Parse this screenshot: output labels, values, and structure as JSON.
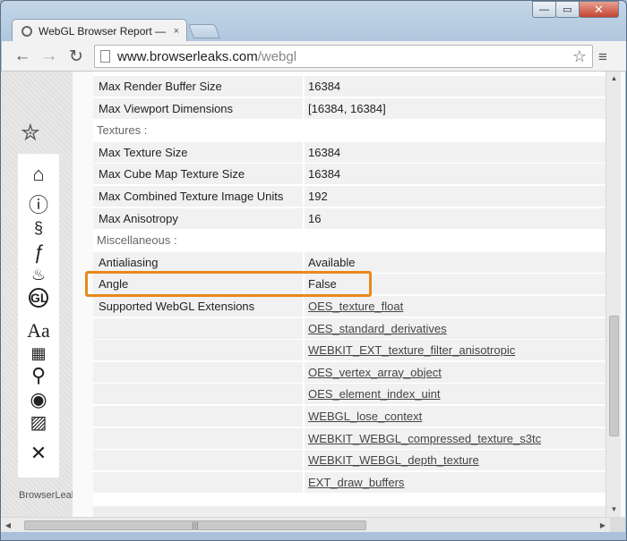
{
  "window": {
    "minimize_glyph": "—",
    "maximize_glyph": "▭",
    "close_glyph": "✕"
  },
  "tab": {
    "title": "WebGL Browser Report —",
    "close_glyph": "×"
  },
  "toolbar": {
    "back_glyph": "←",
    "forward_glyph": "→",
    "reload_glyph": "↻",
    "url_host": "www.browserleaks.com",
    "url_path": "/webgl",
    "star_glyph": "☆",
    "menu_glyph": "≡"
  },
  "sidebar": {
    "brand": "BrowserLeaks",
    "icons": [
      {
        "name": "pin-icon",
        "glyph": "📌"
      },
      {
        "name": "home-icon",
        "glyph": "⌂"
      },
      {
        "name": "info-icon",
        "glyph": "ⓘ"
      },
      {
        "name": "script-icon",
        "glyph": "📜"
      },
      {
        "name": "flash-icon",
        "glyph": "ƒ"
      },
      {
        "name": "java-icon",
        "glyph": "☕"
      },
      {
        "name": "webgl-icon",
        "glyph": "GL"
      },
      {
        "name": "font-icon",
        "glyph": "Aa"
      },
      {
        "name": "firewall-icon",
        "glyph": "▦"
      },
      {
        "name": "geolocation-icon",
        "glyph": "⚲"
      },
      {
        "name": "eye-icon",
        "glyph": "◉"
      },
      {
        "name": "image-icon",
        "glyph": "▨"
      },
      {
        "name": "tools-icon",
        "glyph": "✕"
      }
    ]
  },
  "rows": [
    {
      "label": "Max Render Buffer Size",
      "value": "16384"
    },
    {
      "label": "Max Viewport Dimensions",
      "value": "[16384, 16384]"
    },
    {
      "label": "Textures :",
      "section": true
    },
    {
      "label": "Max Texture Size",
      "value": "16384"
    },
    {
      "label": "Max Cube Map Texture Size",
      "value": "16384"
    },
    {
      "label": "Max Combined Texture Image Units",
      "value": "192"
    },
    {
      "label": "Max Anisotropy",
      "value": "16"
    },
    {
      "label": "Miscellaneous :",
      "section": true
    },
    {
      "label": "Antialiasing",
      "value": "Available"
    },
    {
      "label": "Angle",
      "value": "False"
    },
    {
      "label": "Supported WebGL Extensions",
      "value": "OES_texture_float"
    }
  ],
  "extensions": [
    "OES_texture_float",
    "OES_standard_derivatives",
    "WEBKIT_EXT_texture_filter_anisotropic",
    "OES_vertex_array_object",
    "OES_element_index_uint",
    "WEBGL_lose_context",
    "WEBKIT_WEBGL_compressed_texture_s3tc",
    "WEBKIT_WEBGL_depth_texture",
    "EXT_draw_buffers"
  ],
  "scroll": {
    "up_glyph": "▲",
    "down_glyph": "▼",
    "left_glyph": "◀",
    "right_glyph": "▶",
    "grip_glyph": "|||"
  },
  "colors": {
    "highlight": "#e8891b"
  }
}
